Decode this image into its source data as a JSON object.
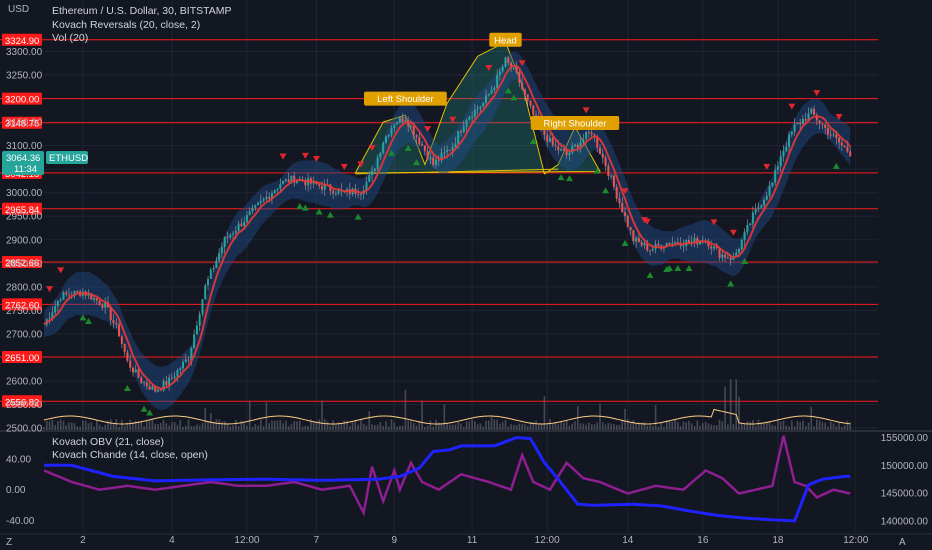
{
  "legend": {
    "symbol": "Ethereum / U.S. Dollar, 30, BITSTAMP",
    "indicator1": "Kovach Reversals (20, close, 2)",
    "indicator2": "Vol (20)",
    "indicator3": "Kovach OBV (21, close)",
    "indicator4": "Kovach Chande (14, close, open)"
  },
  "currency_label": "USD",
  "last_price": {
    "value": "3064.36",
    "countdown": "11:34",
    "symbol": "ETHUSD"
  },
  "colors": {
    "background": "#131722",
    "grid": "#1f2433",
    "candle_up": "#26a69a",
    "candle_down": "#ef5350",
    "band": "#1e4d8c",
    "ma_line": "#e53935",
    "level_line": "#ff1a1a",
    "annotation": "#e0a100",
    "obv_line": "#1e22ff",
    "chande_line": "#8e1e91",
    "volume_ma": "#ffcc80"
  },
  "chart_data": [
    {
      "type": "candlestick",
      "title": "Ethereum / U.S. Dollar, 30, BITSTAMP",
      "x_tick_labels": [
        "2",
        "4",
        "12:00",
        "7",
        "9",
        "11",
        "12:00",
        "14",
        "16",
        "18",
        "12:00"
      ],
      "ylim": [
        2500,
        3350
      ],
      "y_ticks": [
        2500,
        2550,
        2600,
        2700,
        2750,
        2800,
        2850,
        2900,
        2950,
        3000,
        3050,
        3100,
        3150,
        3250,
        3300
      ],
      "y_tick_labels": [
        "2500.00",
        "2550.00",
        "2600.00",
        "2700.00",
        "2750.00",
        "2800.00",
        "2850.00",
        "2900.00",
        "2950.00",
        "3000.00",
        "3050.00",
        "3100.00",
        "3150.00",
        "3250.00",
        "3300.00"
      ],
      "price_levels": [
        "3324.90",
        "3200.00",
        "3148.75",
        "3042.18",
        "2965.84",
        "2852.66",
        "2762.60",
        "2651.00",
        "2556.82"
      ],
      "price_path": {
        "t": [
          0,
          6,
          14,
          22,
          27,
          30,
          35,
          40,
          45,
          52,
          58,
          65,
          75,
          85,
          90,
          96,
          102,
          108,
          114,
          118,
          122,
          126,
          130,
          135,
          140,
          147,
          152,
          158,
          162,
          166,
          170,
          174,
          178,
          183,
          188,
          193,
          197,
          202,
          207,
          212,
          218,
          225,
          232,
          238,
          243,
          248,
          252,
          255,
          258,
          262,
          265,
          270,
          276,
          282,
          287,
          291
        ],
        "price": [
          2720,
          2780,
          2790,
          2760,
          2700,
          2640,
          2600,
          2580,
          2600,
          2650,
          2800,
          2900,
          2960,
          3020,
          3030,
          3020,
          3010,
          3000,
          3005,
          3040,
          3110,
          3150,
          3160,
          3110,
          3060,
          3100,
          3160,
          3190,
          3230,
          3280,
          3250,
          3190,
          3140,
          3100,
          3080,
          3110,
          3130,
          3060,
          2980,
          2900,
          2880,
          2895,
          2895,
          2900,
          2870,
          2860,
          2910,
          2950,
          2980,
          3020,
          3080,
          3140,
          3170,
          3130,
          3100,
          3080
        ]
      },
      "reversal_up_t": [
        14,
        16,
        30,
        36,
        38,
        92,
        94,
        99,
        103,
        113,
        125,
        131,
        134,
        167,
        169,
        176,
        186,
        189,
        199,
        202,
        209,
        218,
        224,
        225,
        228,
        232,
        247,
        252,
        285
      ],
      "reversal_down_t": [
        2,
        6,
        86,
        94,
        98,
        108,
        114,
        118,
        138,
        147,
        160,
        172,
        195,
        209,
        216,
        217,
        241,
        248,
        260,
        269,
        278,
        286
      ],
      "annotations": [
        {
          "label": "Head",
          "t": 166,
          "price": 3325
        },
        {
          "label": "Left Shoulder",
          "t": 130,
          "price": 3200
        },
        {
          "label": "Right Shoulder",
          "t": 191,
          "price": 3148
        }
      ],
      "pattern": {
        "neckline": [
          [
            112,
            3040
          ],
          [
            185,
            3050
          ]
        ],
        "outline_t": [
          112,
          122,
          130,
          137,
          145,
          156,
          166,
          172,
          180,
          185,
          191,
          200
        ]
      },
      "series": [
        {
          "name": "Kovach Reversals (20, close, 2)"
        },
        {
          "name": "Vol (20)"
        }
      ]
    },
    {
      "type": "line",
      "title": "Kovach OBV (21, close)",
      "y_ticks": [
        140000,
        145000,
        150000,
        155000
      ],
      "y_tick_labels": [
        "140000.00",
        "145000.00",
        "150000.00",
        "155000.00"
      ],
      "ylim": [
        138000,
        156000
      ],
      "series": [
        {
          "name": "Kovach OBV (21, close)",
          "t": [
            0,
            10,
            25,
            40,
            60,
            80,
            100,
            120,
            128,
            135,
            140,
            146,
            150,
            162,
            170,
            175,
            180,
            185,
            192,
            198,
            205,
            212,
            222,
            232,
            242,
            252,
            262,
            270,
            275,
            280,
            288,
            290
          ],
          "values": [
            150000,
            150000,
            148000,
            147200,
            147400,
            147500,
            147300,
            147500,
            148000,
            149500,
            152500,
            152800,
            153500,
            153500,
            155000,
            154800,
            150500,
            147500,
            143000,
            142800,
            142900,
            143000,
            142700,
            141800,
            141000,
            140500,
            140200,
            140000,
            146500,
            147500,
            148000,
            148000
          ]
        }
      ]
    },
    {
      "type": "line",
      "title": "Kovach Chande (14, close, open)",
      "y_ticks": [
        -40,
        0,
        40
      ],
      "y_tick_labels": [
        "-40.00",
        "0.00",
        "40.00"
      ],
      "ylim": [
        -55,
        75
      ],
      "series": [
        {
          "name": "Kovach Chande (14, close, open)",
          "t": [
            0,
            10,
            20,
            30,
            40,
            50,
            60,
            70,
            80,
            90,
            100,
            110,
            115,
            118,
            122,
            126,
            128,
            132,
            136,
            142,
            150,
            160,
            168,
            172,
            176,
            182,
            188,
            194,
            200,
            210,
            220,
            230,
            238,
            244,
            250,
            256,
            262,
            266,
            270,
            274,
            278,
            284,
            290
          ],
          "values": [
            25,
            10,
            0,
            5,
            0,
            5,
            10,
            5,
            5,
            10,
            0,
            5,
            -30,
            30,
            -15,
            25,
            0,
            35,
            10,
            0,
            20,
            10,
            0,
            45,
            10,
            0,
            35,
            15,
            10,
            -5,
            5,
            0,
            25,
            15,
            -5,
            0,
            5,
            70,
            10,
            5,
            -10,
            0,
            -5
          ]
        }
      ]
    }
  ]
}
